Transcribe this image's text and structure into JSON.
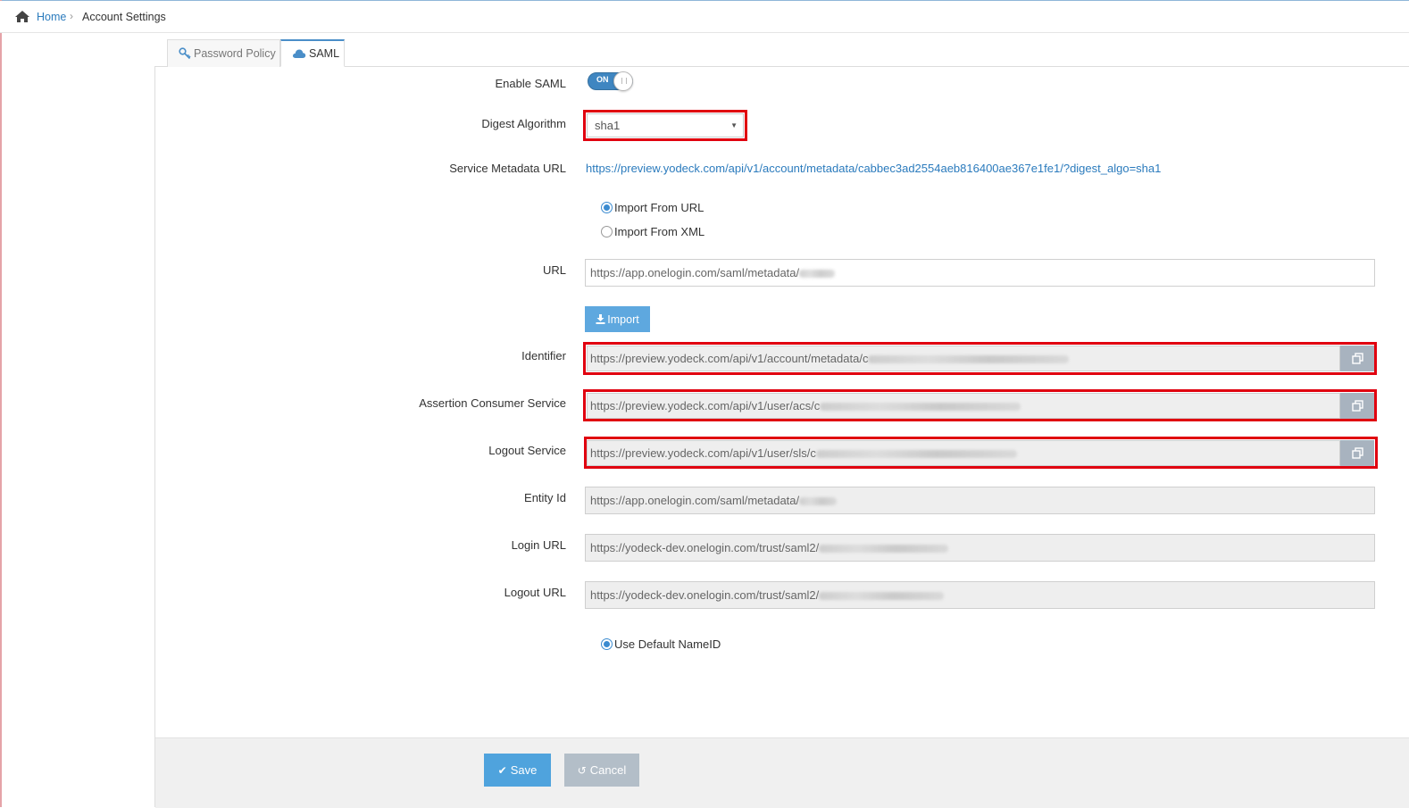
{
  "breadcrumb": {
    "home": "Home",
    "separator": "›",
    "current": "Account Settings"
  },
  "tabs": [
    {
      "label": "Password Policy",
      "icon": "key-icon",
      "active": false
    },
    {
      "label": "SAML",
      "icon": "cloud-icon",
      "active": true
    }
  ],
  "form": {
    "enable_saml": {
      "label": "Enable SAML",
      "toggle_text": "ON",
      "value": true
    },
    "digest_algorithm": {
      "label": "Digest Algorithm",
      "value": "sha1"
    },
    "service_metadata_url": {
      "label": "Service Metadata URL",
      "value": "https://preview.yodeck.com/api/v1/account/metadata/cabbec3ad2554aeb816400ae367e1fe1/?digest_algo=sha1"
    },
    "import_options": [
      {
        "label": "Import From URL",
        "checked": true
      },
      {
        "label": "Import From XML",
        "checked": false
      }
    ],
    "url": {
      "label": "URL",
      "value": "https://app.onelogin.com/saml/metadata/"
    },
    "import_button": "Import",
    "identifier": {
      "label": "Identifier",
      "value": "https://preview.yodeck.com/api/v1/account/metadata/c"
    },
    "assertion_consumer_service": {
      "label": "Assertion Consumer Service",
      "value": "https://preview.yodeck.com/api/v1/user/acs/c"
    },
    "logout_service": {
      "label": "Logout Service",
      "value": "https://preview.yodeck.com/api/v1/user/sls/c"
    },
    "entity_id": {
      "label": "Entity Id",
      "value": "https://app.onelogin.com/saml/metadata/"
    },
    "login_url": {
      "label": "Login URL",
      "value": "https://yodeck-dev.onelogin.com/trust/saml2/"
    },
    "logout_url": {
      "label": "Logout URL",
      "value": "https://yodeck-dev.onelogin.com/trust/saml2/"
    },
    "use_default_nameid": {
      "label": "Use Default NameID",
      "checked": true
    }
  },
  "footer": {
    "save_label": "Save",
    "cancel_label": "Cancel"
  },
  "colors": {
    "accent": "#3f86c1",
    "highlight": "#e0000f",
    "link": "#2b7bbd"
  }
}
